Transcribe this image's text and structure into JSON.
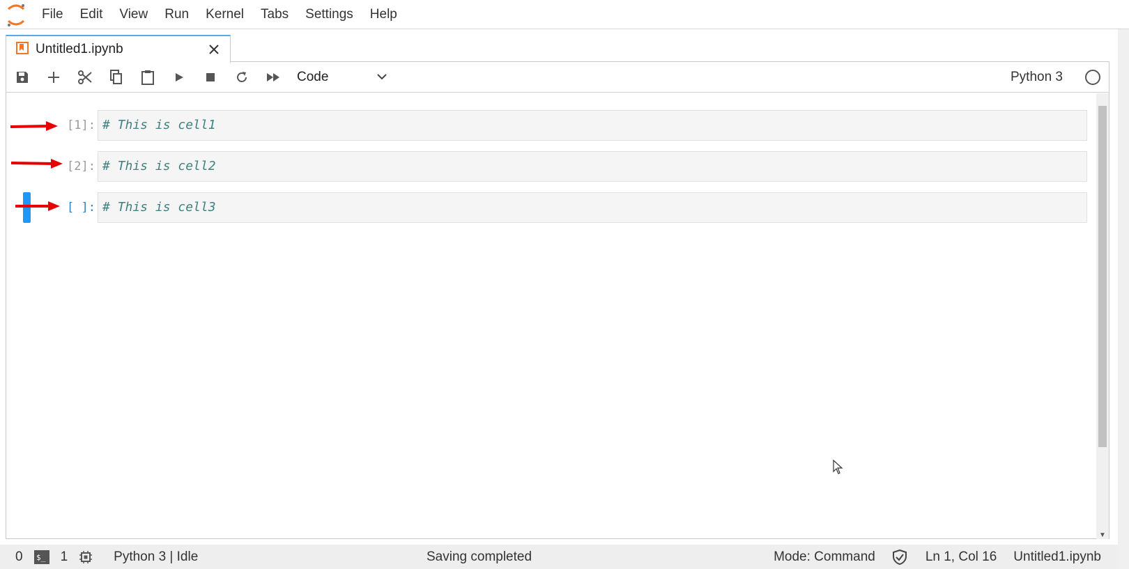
{
  "menubar": {
    "items": [
      "File",
      "Edit",
      "View",
      "Run",
      "Kernel",
      "Tabs",
      "Settings",
      "Help"
    ],
    "logo_icon": "jupyter-logo-icon"
  },
  "tab": {
    "label": "Untitled1.ipynb",
    "icon": "notebook-icon",
    "close_icon": "close-icon"
  },
  "toolbar": {
    "buttons": [
      "save-icon",
      "add-cell-icon",
      "cut-icon",
      "copy-icon",
      "paste-icon",
      "run-icon",
      "stop-icon",
      "restart-icon",
      "run-all-icon"
    ],
    "cell_type": "Code",
    "kernel_name": "Python 3",
    "kernel_status_icon": "kernel-idle-circle-icon"
  },
  "cells": [
    {
      "prompt": "[1]:",
      "source": "# This is cell1",
      "active": false
    },
    {
      "prompt": "[2]:",
      "source": "# This is cell2",
      "active": false
    },
    {
      "prompt": "[ ]:",
      "source": "# This is cell3",
      "active": true
    }
  ],
  "colors": {
    "accent": "#2196f3",
    "arrow": "#e60000",
    "comment": "#408080"
  },
  "statusbar": {
    "terminals_count": "0",
    "kernels_count": "1",
    "kernel_status": "Python 3 | Idle",
    "message": "Saving completed",
    "mode": "Mode: Command",
    "position": "Ln 1, Col 16",
    "filename": "Untitled1.ipynb"
  }
}
